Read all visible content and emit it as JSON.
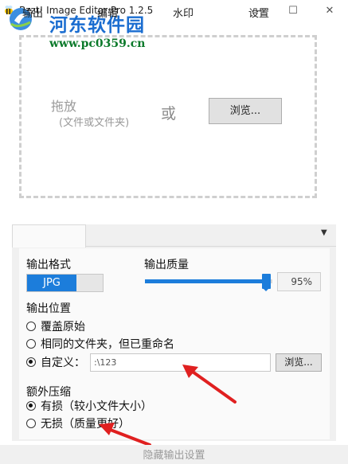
{
  "window": {
    "title": "Bzzt! Image Editor Pro 1.2.5",
    "minimize_glyph": "—",
    "maximize_glyph": "☐",
    "close_glyph": "✕"
  },
  "watermark": {
    "site_name": "河东软件园",
    "url": "www.pc0359.cn"
  },
  "drop_zone": {
    "title": "拖放",
    "hint": "(文件或文件夹)",
    "or_text": "或",
    "browse_label": "浏览..."
  },
  "tabs": [
    {
      "label": "输出",
      "active": true
    },
    {
      "label": "编辑",
      "active": false
    },
    {
      "label": "水印",
      "active": false
    },
    {
      "label": "设置",
      "active": false
    }
  ],
  "tabs_more_glyph": "▼",
  "output": {
    "format_label": "输出格式",
    "format_value": "JPG",
    "quality_label": "输出质量",
    "quality_value": "95%",
    "quality_level": 0.95,
    "location_label": "输出位置",
    "location_options": [
      {
        "label": "覆盖原始",
        "selected": false
      },
      {
        "label": "相同的文件夹，但已重命名",
        "selected": false
      },
      {
        "label": "自定义：",
        "selected": true
      }
    ],
    "custom_path": ":\\123",
    "custom_browse_label": "浏览...",
    "compression_label": "额外压缩",
    "compression_options": [
      {
        "label": "有损（较小文件大小）",
        "selected": true
      },
      {
        "label": "无损（质量更好）",
        "selected": false
      }
    ]
  },
  "footer": {
    "hide_settings_label": "隐藏输出设置"
  },
  "colors": {
    "accent": "#1c7ddb",
    "annotation_arrow": "#e02020",
    "panel_bg": "#f0f0f0"
  }
}
